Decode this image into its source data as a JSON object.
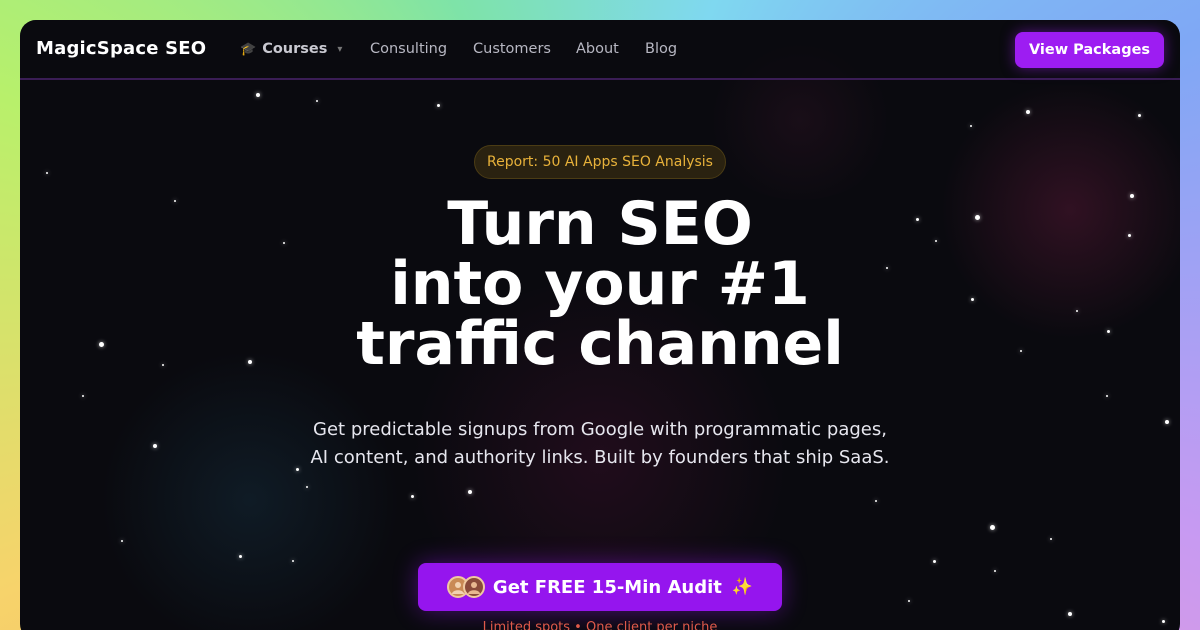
{
  "nav": {
    "brand": "MagicSpace SEO",
    "courses_label": "Courses",
    "links": [
      "Consulting",
      "Customers",
      "About",
      "Blog"
    ],
    "cta_label": "View Packages"
  },
  "hero": {
    "badge": "Report: 50 AI Apps SEO Analysis",
    "headline": [
      "Turn SEO",
      "into your #1",
      "traffic channel"
    ],
    "subtitle": "Get predictable signups from Google with programmatic pages, AI content, and authority links. Built by founders that ship SaaS.",
    "cta_label": "Get FREE 15-Min Audit",
    "note": "Limited spots • One client per niche"
  },
  "colors": {
    "accent": "#9d1df2",
    "badge_text": "#e8b23a",
    "note_text": "#e05a4a",
    "background": "#0a0a0f"
  },
  "icons": {
    "courses": "graduation-cap-icon",
    "courses_dropdown": "chevron-down-icon",
    "cta_sparkle": "sparkle-icon",
    "cta_avatars": "avatar-icon"
  }
}
